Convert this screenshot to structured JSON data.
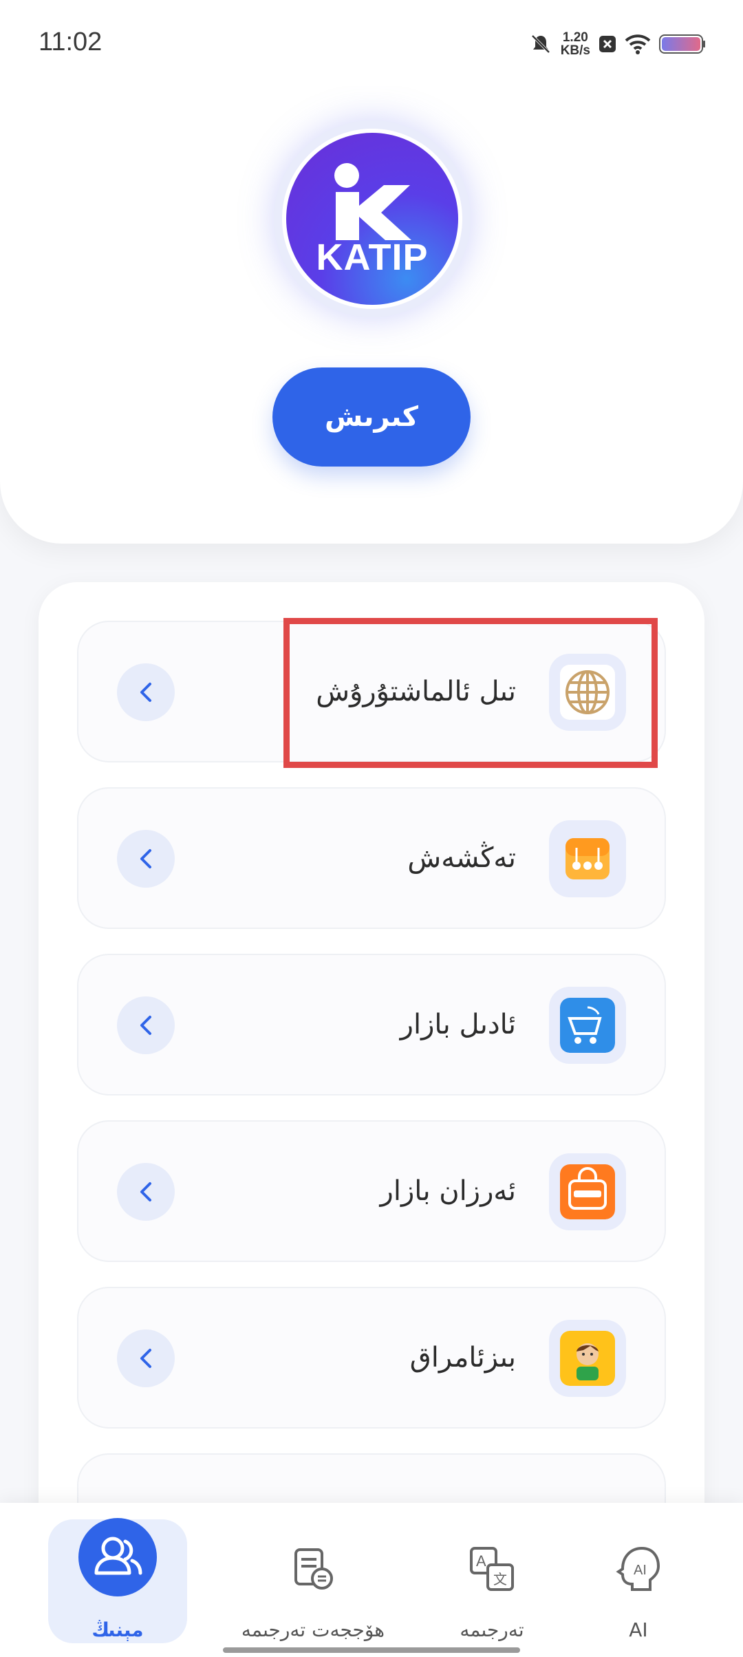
{
  "status_bar": {
    "time": "11:02",
    "net_speed_value": "1.20",
    "net_speed_unit": "KB/s",
    "icons": [
      "bell-muted-icon",
      "close-box-icon",
      "wifi-icon",
      "battery-icon"
    ]
  },
  "header": {
    "logo_text": "KATIP",
    "login_label": "كىرىش"
  },
  "menu": {
    "items": [
      {
        "label": "تىل ئالماشتۇرۇش",
        "icon": "globe-icon"
      },
      {
        "label": "تەڭشەش",
        "icon": "settings-icon"
      },
      {
        "label": "ئادىل بازار",
        "icon": "adil-bazar-app-icon"
      },
      {
        "label": "ئەرزان بازار",
        "icon": "arzan-app-icon"
      },
      {
        "label": "بىزئامراق",
        "icon": "bizamraq-app-icon"
      }
    ]
  },
  "bottom_nav": {
    "items": [
      {
        "label": "مېنىڭ",
        "icon": "users-icon",
        "active": true
      },
      {
        "label": "ھۆججەت تەرجىمە",
        "icon": "document-translate-icon",
        "active": false
      },
      {
        "label": "تەرجىمە",
        "icon": "translate-icon",
        "active": false
      },
      {
        "label": "AI",
        "icon": "ai-head-icon",
        "active": false
      }
    ]
  },
  "colors": {
    "accent": "#2f64e8",
    "highlight": "#e04848"
  }
}
